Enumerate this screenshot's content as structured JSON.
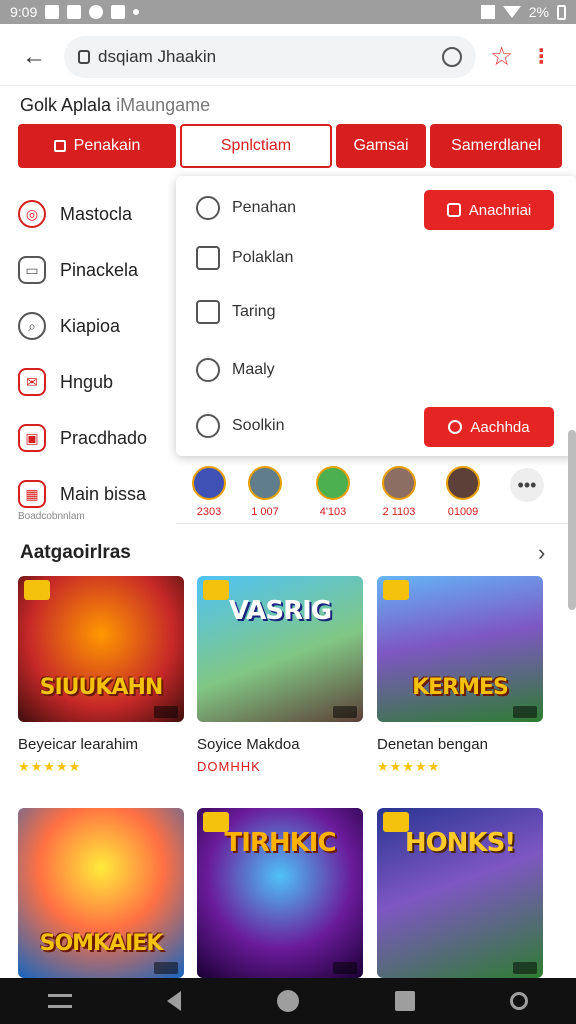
{
  "status_bar": {
    "time": "9:09",
    "battery": "2%"
  },
  "address_bar": {
    "url": "dsqiam Jhaakin"
  },
  "page": {
    "heading": "Golk Aplala",
    "heading_muted": "iMaungame"
  },
  "tabs": [
    "Penakain",
    "Spnlctiam",
    "Gamsai",
    "Samerdlanel"
  ],
  "sidebar": {
    "items": [
      {
        "label": "Mastocla",
        "icon": "target-icon"
      },
      {
        "label": "Pinackela",
        "icon": "folder-icon"
      },
      {
        "label": "Kiapioa",
        "icon": "search-icon"
      },
      {
        "label": "Hngub",
        "icon": "message-icon"
      },
      {
        "label": "Pracdhado",
        "icon": "chat-icon"
      },
      {
        "label": "Main bissa",
        "icon": "grid-icon"
      }
    ],
    "caption": "Boadcobnnlam"
  },
  "popup": {
    "items": [
      {
        "label": "Penahan",
        "icon": "clock-icon"
      },
      {
        "label": "Polaklan",
        "icon": "bag-icon"
      },
      {
        "label": "Taring",
        "icon": "trophy-icon"
      },
      {
        "label": "Maaly",
        "icon": "speech-icon"
      },
      {
        "label": "Soolkin",
        "icon": "compass-icon"
      }
    ],
    "primary_button": "Anachriai",
    "secondary_button": "Aachhda"
  },
  "avatars": [
    {
      "count": "2303"
    },
    {
      "count": "1 007"
    },
    {
      "count": "4'103"
    },
    {
      "count": "2 1103"
    },
    {
      "count": "01009"
    }
  ],
  "categories": {
    "title": "Aatgaoirlras",
    "items": [
      {
        "name": "Beyeicar learahim",
        "art": "SIUUKAHN",
        "stars": "★★★★★",
        "stars_color": "#f4c20d"
      },
      {
        "name": "Soyice Makdoa",
        "art": "VASRIG",
        "stars": "DOMHHK",
        "stars_color": "#d71f1f"
      },
      {
        "name": "Denetan bengan",
        "art": "KERMES",
        "stars": "★★★★★",
        "stars_color": "#f4c20d"
      },
      {
        "name": "",
        "art": "SOMKAIEK",
        "stars": "",
        "stars_color": "#f4c20d"
      },
      {
        "name": "",
        "art": "TIRHKIC",
        "stars": "",
        "stars_color": "#f4c20d"
      },
      {
        "name": "",
        "art": "HONKS!",
        "stars": "",
        "stars_color": "#f4c20d"
      }
    ]
  },
  "colors": {
    "accent": "#d71f1f",
    "status_bar": "#9e9e9e",
    "nav_bar": "#111111"
  }
}
